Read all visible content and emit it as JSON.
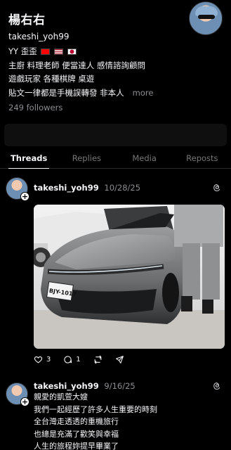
{
  "profile": {
    "display_name": "楊右右",
    "handle": "takeshi_yoh99",
    "bio_line1": "YY 歪歪",
    "bio_line2": "主廚 料理老師 便當達人 感情諮詢顧問",
    "bio_line3": "遊戲玩家 各種棋牌 桌遊",
    "bio_line4": "貼文一律都是手機誤轉發 非本人",
    "more_label": "more",
    "followers": "249 followers"
  },
  "tabs": [
    {
      "label": "Threads",
      "active": true
    },
    {
      "label": "Replies"
    },
    {
      "label": "Media"
    },
    {
      "label": "Reposts"
    }
  ],
  "posts": [
    {
      "user": "takeshi_yoh99",
      "date": "10/28/25",
      "likes": "3",
      "replies": "1"
    },
    {
      "user": "takeshi_yoh99",
      "date": "9/16/25",
      "lines": [
        "親愛的凱萱大嫂",
        "我們一起經歷了許多人生重要的時刻",
        "全台灣走透透的重機旅行",
        "也總是充滿了歡笑與幸福",
        "人生的旅程妳提早畢業了"
      ]
    }
  ],
  "colors": {
    "background": "#000000",
    "text": "#f3f5f7",
    "muted": "#8a8d91"
  },
  "license_plate": "BJY-1017"
}
